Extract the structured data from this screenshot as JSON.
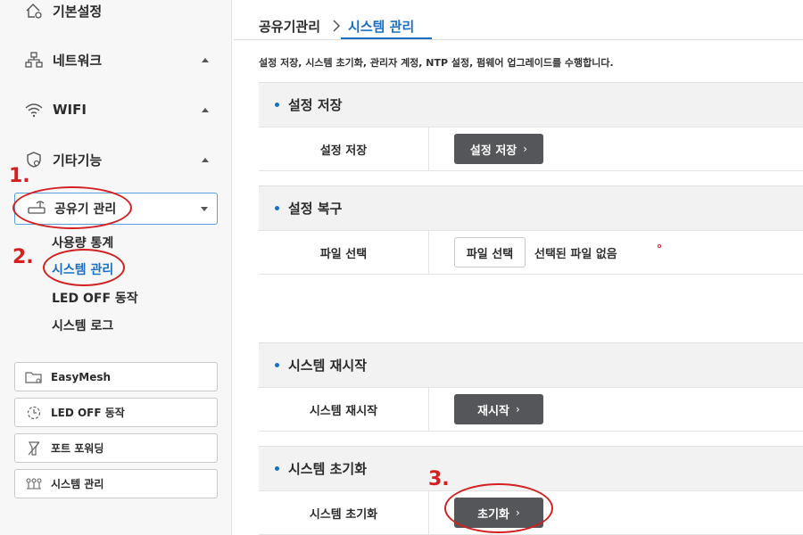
{
  "sidebar": {
    "menu": [
      {
        "label": "기본설정",
        "icon": "home-gear-icon"
      },
      {
        "label": "네트워크",
        "icon": "network-icon"
      },
      {
        "label": "WIFI",
        "icon": "wifi-icon"
      },
      {
        "label": "기타기능",
        "icon": "shield-icon"
      }
    ],
    "router_menu": {
      "label": "공유기 관리",
      "icon": "router-icon"
    },
    "submenu": [
      {
        "label": "사용량 통계"
      },
      {
        "label": "시스템 관리"
      },
      {
        "label": "LED OFF 동작"
      },
      {
        "label": "시스템 로그"
      }
    ],
    "quick_buttons": [
      {
        "label": "EasyMesh",
        "icon": "folder-icon"
      },
      {
        "label": "LED OFF 동작",
        "icon": "timer-icon"
      },
      {
        "label": "포트 포워딩",
        "icon": "port-icon"
      },
      {
        "label": "시스템 관리",
        "icon": "system-icon"
      }
    ]
  },
  "breadcrumb": {
    "root": "공유기관리",
    "current": "시스템 관리"
  },
  "description": "설정 저장, 시스템 초기화, 관리자 계정, NTP 설정, 펌웨어 업그레이드를 수행합니다.",
  "sections": {
    "save": {
      "title": "설정 저장",
      "row_label": "설정 저장",
      "button": "설정 저장"
    },
    "restore": {
      "title": "설정 복구",
      "row_label": "파일 선택",
      "button": "파일 선택",
      "status": "선택된 파일 없음"
    },
    "reboot": {
      "title": "시스템 재시작",
      "row_label": "시스템 재시작",
      "button": "재시작"
    },
    "reset": {
      "title": "시스템 초기화",
      "row_label": "시스템 초기화",
      "button": "초기화"
    }
  },
  "annotations": [
    "1.",
    "2.",
    "3."
  ],
  "colors": {
    "accent": "#1a6fc4",
    "annotation": "#d42020",
    "button_dark": "#555659"
  }
}
